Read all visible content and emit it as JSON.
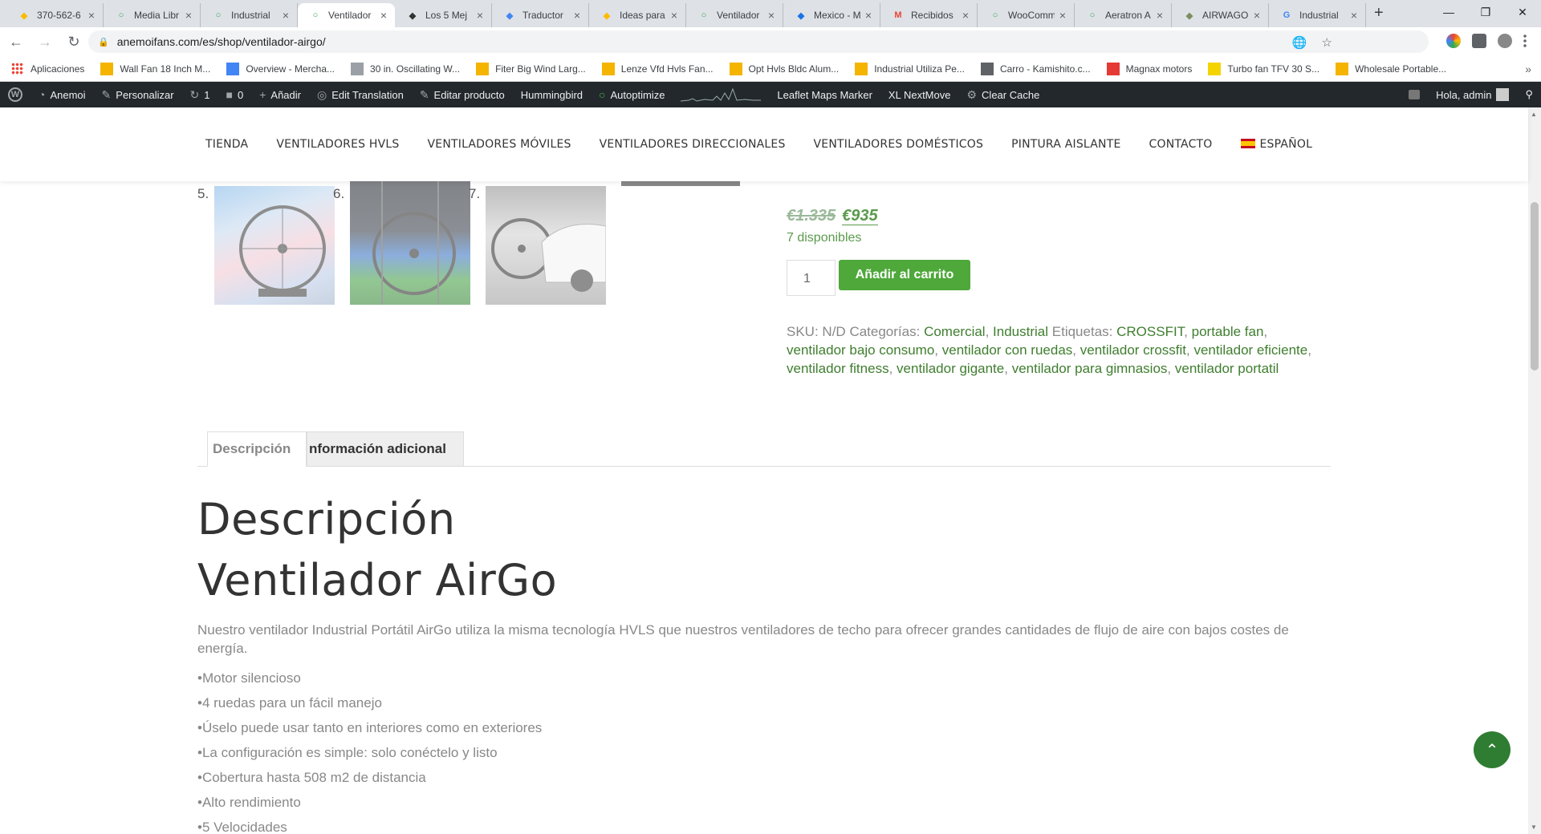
{
  "browser": {
    "tabs": [
      {
        "title": "370-562-6",
        "icon": "google-ads-icon",
        "color": "#fbbc04"
      },
      {
        "title": "Media Libr",
        "icon": "wp-loop-icon",
        "color": "#34a853"
      },
      {
        "title": "Industrial",
        "icon": "wp-loop-icon",
        "color": "#34a853"
      },
      {
        "title": "Ventilador",
        "icon": "wp-loop-icon",
        "color": "#34a853"
      },
      {
        "title": "Los 5 Mej",
        "icon": "c-logo-icon",
        "color": "#333333"
      },
      {
        "title": "Traductor",
        "icon": "translate-icon",
        "color": "#4285f4"
      },
      {
        "title": "Ideas para",
        "icon": "google-ads-icon",
        "color": "#fbbc04"
      },
      {
        "title": "Ventilador",
        "icon": "wp-loop-icon",
        "color": "#34a853"
      },
      {
        "title": "Mexico - M",
        "icon": "blue-square-icon",
        "color": "#1a73e8"
      },
      {
        "title": "Recibidos",
        "icon": "gmail-icon",
        "color": "#ea4335"
      },
      {
        "title": "WooComm",
        "icon": "wp-loop-icon",
        "color": "#34a853"
      },
      {
        "title": "Aeratron A",
        "icon": "wp-loop-icon",
        "color": "#34a853"
      },
      {
        "title": "AIRWAGO",
        "icon": "airwago-icon",
        "color": "#7a8f5f"
      },
      {
        "title": "Industrial",
        "icon": "google-g-icon",
        "color": "#4285f4"
      }
    ],
    "url": "anemoifans.com/es/shop/ventilador-airgo/",
    "bookmarks": [
      {
        "label": "Aplicaciones",
        "color": "#ea4335"
      },
      {
        "label": "Wall Fan 18 Inch M...",
        "color": "#f4b400"
      },
      {
        "label": "Overview - Mercha...",
        "color": "#4285f4"
      },
      {
        "label": "30 in. Oscillating W...",
        "color": "#9aa0a6"
      },
      {
        "label": "Fiter Big Wind Larg...",
        "color": "#f4b400"
      },
      {
        "label": "Lenze Vfd Hvls Fan...",
        "color": "#f4b400"
      },
      {
        "label": "Opt Hvls Bldc Alum...",
        "color": "#f4b400"
      },
      {
        "label": "Industrial Utiliza Pe...",
        "color": "#f4b400"
      },
      {
        "label": "Carro - Kamishito.c...",
        "color": "#5f6368"
      },
      {
        "label": "Magnax motors",
        "color": "#e53935"
      },
      {
        "label": "Turbo fan TFV 30 S...",
        "color": "#f4d400"
      },
      {
        "label": "Wholesale Portable...",
        "color": "#f4b400"
      }
    ]
  },
  "wpbar": {
    "items": [
      {
        "label": "Anemoi",
        "icon": "dashboard-icon"
      },
      {
        "label": "Personalizar",
        "icon": "brush-icon"
      },
      {
        "label": "1",
        "icon": "updates-icon"
      },
      {
        "label": "0",
        "icon": "comment-icon"
      },
      {
        "label": "Añadir",
        "icon": "plus-icon"
      },
      {
        "label": "Edit Translation",
        "icon": "translate-icon"
      },
      {
        "label": "Editar producto",
        "icon": "pencil-icon"
      },
      {
        "label": "Hummingbird",
        "icon": ""
      },
      {
        "label": "Autoptimize",
        "icon": "status-dot-icon"
      }
    ],
    "items2": [
      {
        "label": "Leaflet Maps Marker"
      },
      {
        "label": "XL NextMove"
      },
      {
        "label": "Clear Cache"
      }
    ],
    "greeting": "Hola, admin"
  },
  "nav": {
    "items": [
      "TIENDA",
      "VENTILADORES HVLS",
      "VENTILADORES MÓVILES",
      "VENTILADORES DIRECCIONALES",
      "VENTILADORES DOMÉSTICOS",
      "PINTURA AISLANTE",
      "CONTACTO"
    ],
    "language": "ESPAÑOL"
  },
  "gallery": {
    "numbers": [
      "5.",
      "6.",
      "7."
    ]
  },
  "product": {
    "old_price": "€1.335",
    "new_price": "€935",
    "stock": "7 disponibles",
    "quantity": "1",
    "add_to_cart": "Añadir al carrito",
    "sku_label": "SKU:",
    "sku_value": "N/D",
    "categories_label": "Categorías:",
    "categories": [
      "Comercial",
      "Industrial"
    ],
    "tags_label": "Etiquetas:",
    "tags": [
      "CROSSFIT",
      "portable fan",
      "ventilador bajo consumo",
      "ventilador con ruedas",
      "ventilador crossfit",
      "ventilador eficiente",
      "ventilador fitness",
      "ventilador gigante",
      "ventilador para gimnasios",
      "ventilador portatil"
    ]
  },
  "tabs": {
    "description": "Descripción",
    "additional": "nformación adicional"
  },
  "description": {
    "heading": "Descripción",
    "title": "Ventilador AirGo",
    "paragraph": "Nuestro ventilador Industrial Portátil AirGo utiliza la misma tecnología HVLS que nuestros ventiladores de techo para ofrecer grandes cantidades de flujo de aire con bajos costes de energía.",
    "features": [
      "•Motor silencioso",
      "•4 ruedas para un fácil manejo",
      "•Úselo puede usar tanto en interiores como en exteriores",
      "•La configuración es simple: solo conéctelo y listo",
      "•Cobertura hasta 508 m2 de distancia",
      "•Alto rendimiento",
      "•5 Velocidades"
    ]
  },
  "colors": {
    "accent_green": "#4ea83a",
    "link_green": "#3f7e2f",
    "wpbar_bg": "#23282d"
  }
}
